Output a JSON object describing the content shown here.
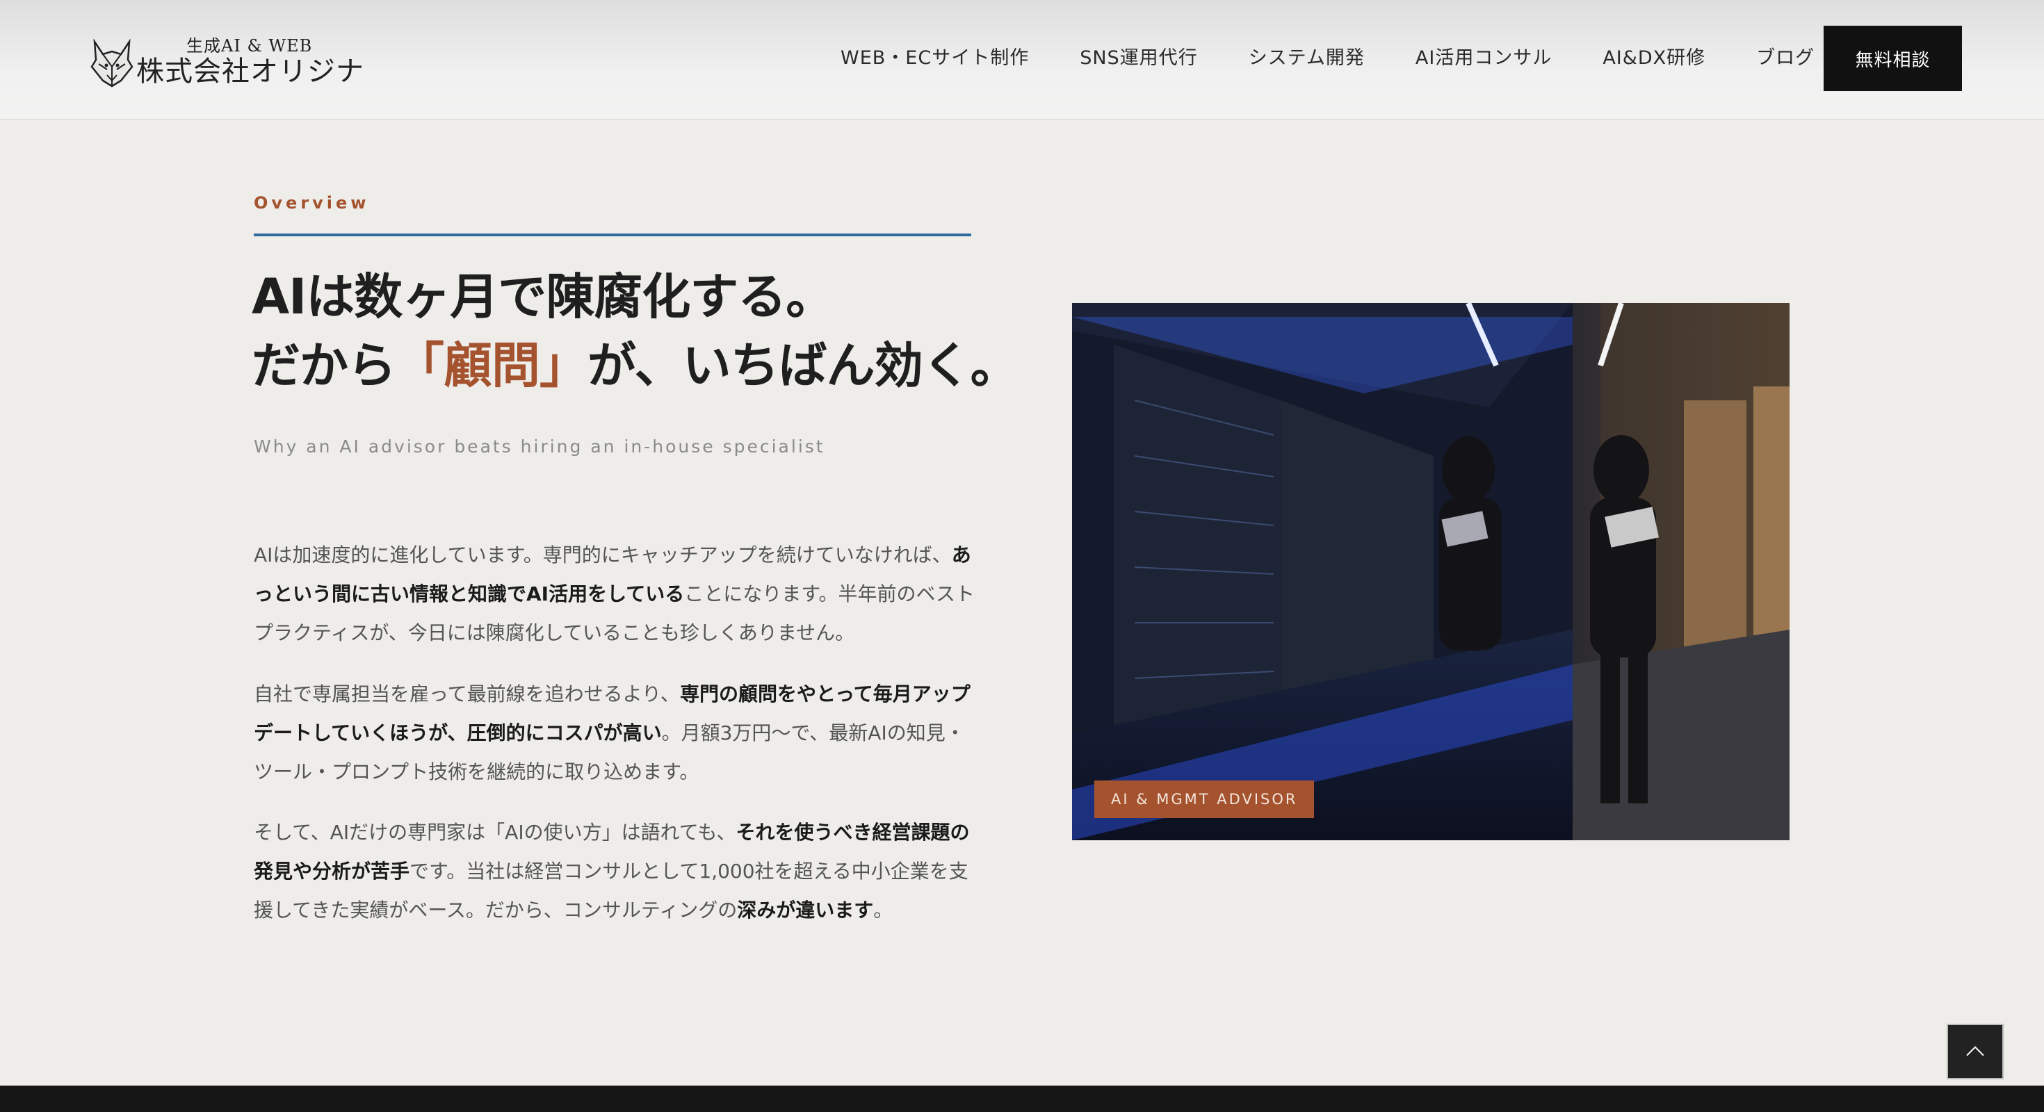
{
  "header": {
    "logo": {
      "tagline": "生成AI & WEB",
      "name": "株式会社オリジナ",
      "mark_icon": "fox-head-icon"
    },
    "nav": [
      {
        "label": "WEB・ECサイト制作",
        "id": "web-ec"
      },
      {
        "label": "SNS運用代行",
        "id": "sns"
      },
      {
        "label": "システム開発",
        "id": "system"
      },
      {
        "label": "AI活用コンサル",
        "id": "ai-consul"
      },
      {
        "label": "AI&DX研修",
        "id": "ai-dx"
      },
      {
        "label": "ブログ",
        "id": "blog"
      }
    ],
    "cta_label": "無料相談"
  },
  "section": {
    "eyebrow": "Overview",
    "headline_line1": "AIは数ヶ月で陳腐化する。",
    "headline_line2_pre": "だから",
    "headline_line2_accent": "「顧問」",
    "headline_line2_post": "が、いちばん効く。",
    "subtitle": "Why an AI advisor beats hiring an in-house specialist",
    "paragraphs": [
      {
        "t1": "AIは加速度的に進化しています。専門的にキャッチアップを続けていなければ、",
        "b1": "あっという間に古い情報と知識でAI活用をしている",
        "t2": "ことになります。半年前のベストプラクティスが、今日には陳腐化していることも珍しくありません。"
      },
      {
        "t1": "自社で専属担当を雇って最前線を追わせるより、",
        "b1": "専門の顧問をやとって毎月アップデートしていくほうが、圧倒的にコスパが高い",
        "t2": "。月額3万円〜で、最新AIの知見・ツール・プロンプト技術を継続的に取り込めます。"
      },
      {
        "t1": "そして、AIだけの専門家は「AIの使い方」は語れても、",
        "b1": "それを使うべき経営課題の発見や分析が苦手",
        "t2": "です。当社は経営コンサルとして1,000社を超える中小企業を支援してきた実績がベース。だから、コンサルティングの",
        "b2": "深みが違います",
        "t3": "。"
      }
    ],
    "photo_badge": "AI & MGMT ADVISOR"
  },
  "colors": {
    "accent": "#a4532e",
    "rule": "#2e6b9e",
    "cta_bg": "#111111"
  },
  "back_to_top_icon": "chevron-up-icon"
}
